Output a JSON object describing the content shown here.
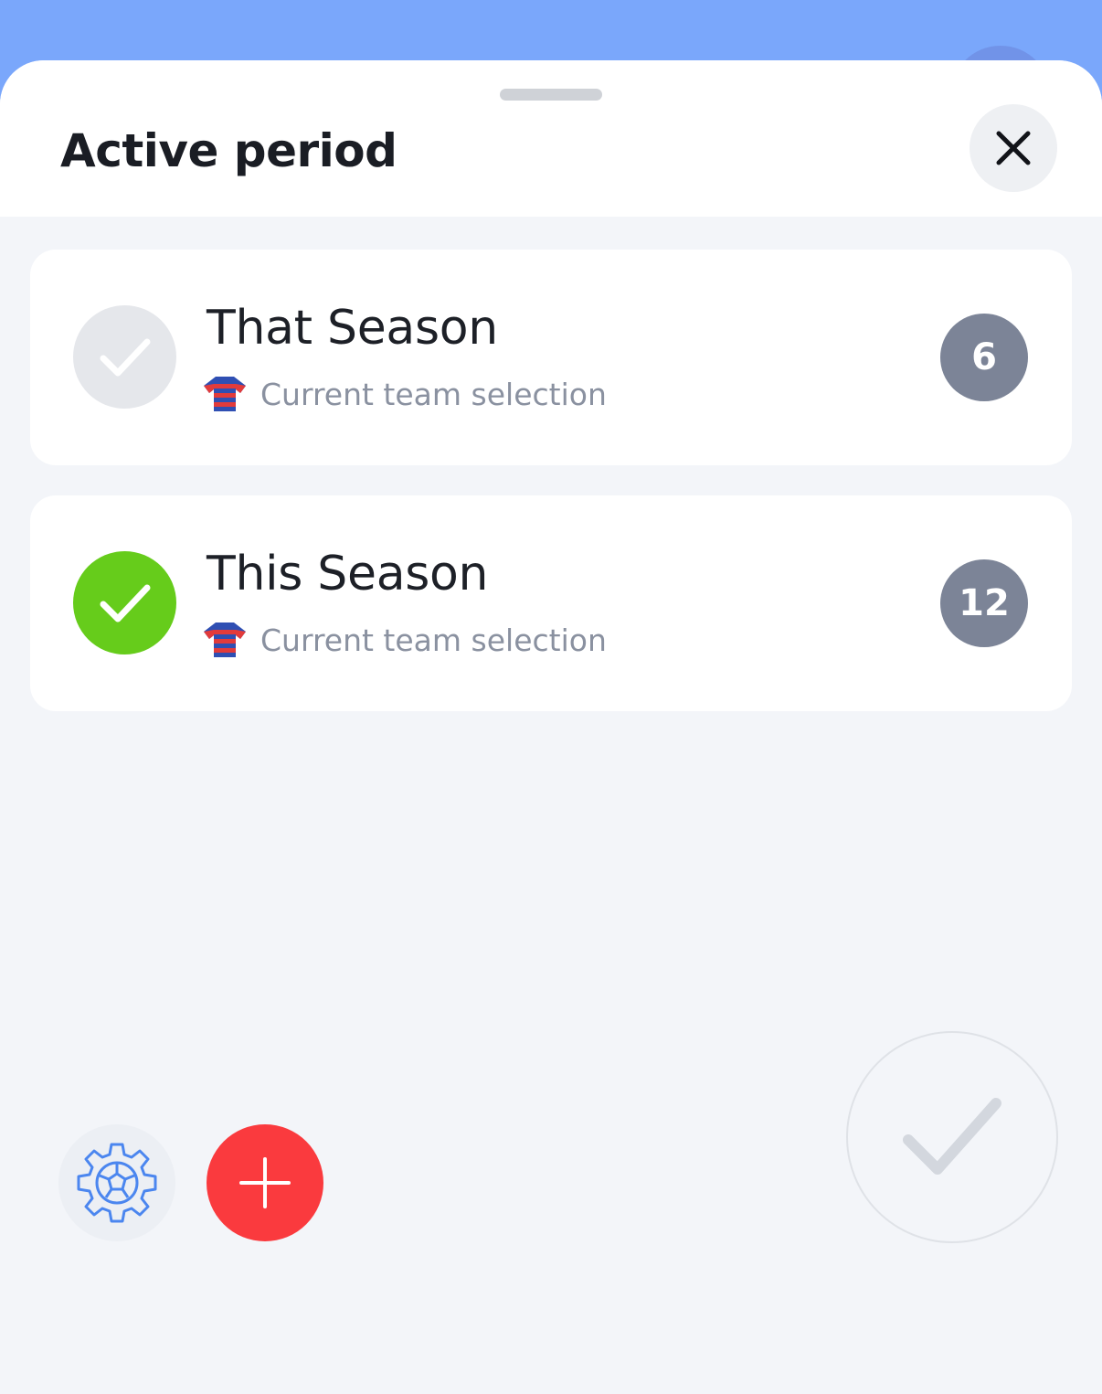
{
  "sheet": {
    "title": "Active period",
    "close_icon": "close-icon"
  },
  "periods": [
    {
      "name": "That Season",
      "subtitle": "Current team selection",
      "count": "6",
      "active": false
    },
    {
      "name": "This Season",
      "subtitle": "Current team selection",
      "count": "12",
      "active": true
    }
  ],
  "actions": {
    "settings_icon": "gear-ball-icon",
    "add_icon": "plus-icon",
    "confirm_icon": "check-icon"
  },
  "colors": {
    "backdrop": "#7aa7fb",
    "active_check": "#66cc1b",
    "add_button": "#fa3a3e",
    "badge": "#7c8497"
  }
}
